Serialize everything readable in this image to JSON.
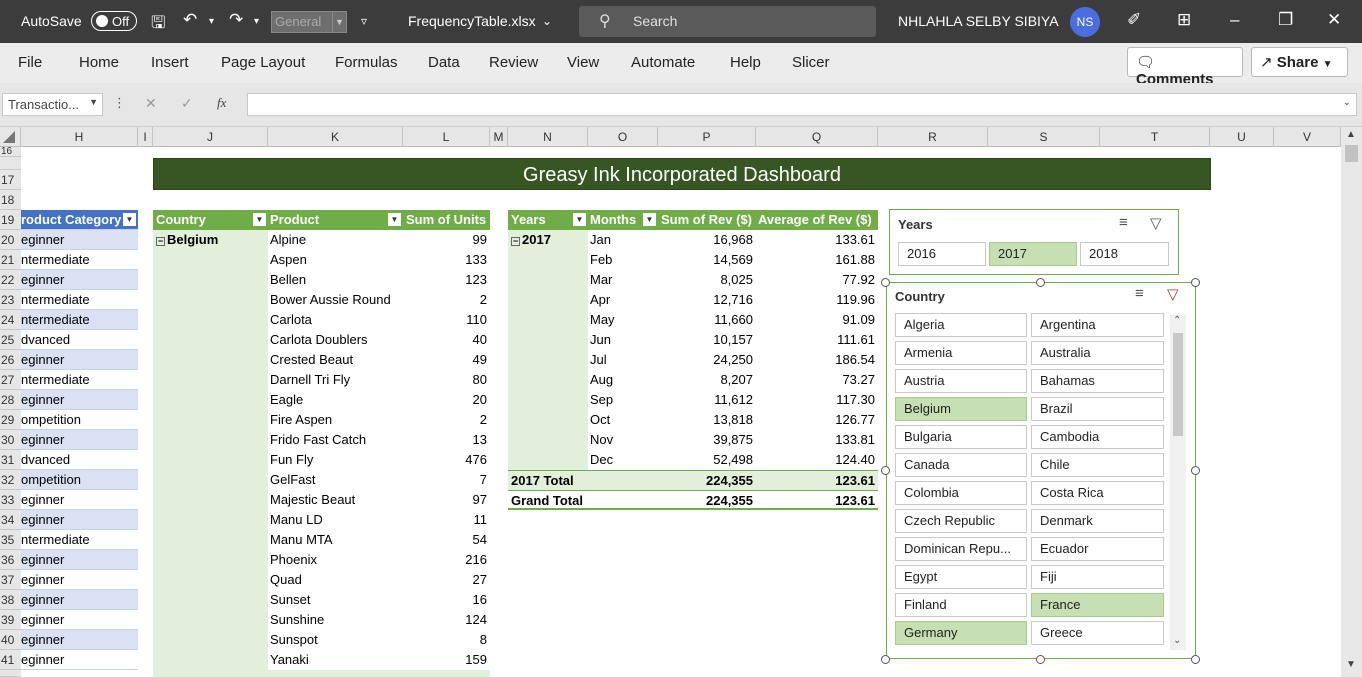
{
  "titlebar": {
    "autosave": "AutoSave",
    "toggle": "Off",
    "font": "General",
    "filename": "FrequencyTable.xlsx",
    "search": "Search",
    "user": "NHLAHLA SELBY SIBIYA",
    "initials": "NS"
  },
  "ribbon": {
    "tabs": [
      "File",
      "Home",
      "Insert",
      "Page Layout",
      "Formulas",
      "Data",
      "Review",
      "View",
      "Automate",
      "Help",
      "Slicer"
    ],
    "comments": "Comments",
    "share": "Share"
  },
  "formula": {
    "namebox": "Transactio...",
    "fx": "fx"
  },
  "columns": [
    "H",
    "I",
    "J",
    "K",
    "L",
    "M",
    "N",
    "O",
    "P",
    "Q",
    "R",
    "S",
    "T",
    "U",
    "V"
  ],
  "rows": [
    "16",
    "17",
    "18",
    "19",
    "20",
    "21",
    "22",
    "23",
    "24",
    "25",
    "26",
    "27",
    "28",
    "29",
    "30",
    "31",
    "32",
    "33",
    "34",
    "35",
    "36",
    "37",
    "38",
    "39",
    "40",
    "41"
  ],
  "colH": {
    "header": "roduct Category",
    "cells": [
      "eginner",
      "ntermediate",
      "eginner",
      "ntermediate",
      "ntermediate",
      "dvanced",
      "eginner",
      "ntermediate",
      "eginner",
      "ompetition",
      "eginner",
      "dvanced",
      "ompetition",
      "eginner",
      "eginner",
      "ntermediate",
      "eginner",
      "eginner",
      "eginner",
      "eginner",
      "eginner",
      "eginner"
    ]
  },
  "dashboard": {
    "title": "Greasy Ink Incorporated Dashboard"
  },
  "pivot1": {
    "headers": [
      "Country",
      "Product",
      "Sum of Units"
    ],
    "country": "Belgium",
    "rows": [
      [
        "Alpine",
        "99"
      ],
      [
        "Aspen",
        "133"
      ],
      [
        "Bellen",
        "123"
      ],
      [
        "Bower Aussie Round",
        "2"
      ],
      [
        "Carlota",
        "110"
      ],
      [
        "Carlota Doublers",
        "40"
      ],
      [
        "Crested Beaut",
        "49"
      ],
      [
        "Darnell Tri Fly",
        "80"
      ],
      [
        "Eagle",
        "20"
      ],
      [
        "Fire Aspen",
        "2"
      ],
      [
        "Frido Fast Catch",
        "13"
      ],
      [
        "Fun Fly",
        "476"
      ],
      [
        "GelFast",
        "7"
      ],
      [
        "Majestic Beaut",
        "97"
      ],
      [
        "Manu LD",
        "11"
      ],
      [
        "Manu MTA",
        "54"
      ],
      [
        "Phoenix",
        "216"
      ],
      [
        "Quad",
        "27"
      ],
      [
        "Sunset",
        "16"
      ],
      [
        "Sunshine",
        "124"
      ],
      [
        "Sunspot",
        "8"
      ],
      [
        "Yanaki",
        "159"
      ]
    ]
  },
  "pivot2": {
    "headers": [
      "Years",
      "Months",
      "Sum of Rev ($)",
      "Average of Rev ($)"
    ],
    "year": "2017",
    "rows": [
      [
        "Jan",
        "16,968",
        "133.61"
      ],
      [
        "Feb",
        "14,569",
        "161.88"
      ],
      [
        "Mar",
        "8,025",
        "77.92"
      ],
      [
        "Apr",
        "12,716",
        "119.96"
      ],
      [
        "May",
        "11,660",
        "91.09"
      ],
      [
        "Jun",
        "10,157",
        "111.61"
      ],
      [
        "Jul",
        "24,250",
        "186.54"
      ],
      [
        "Aug",
        "8,207",
        "73.27"
      ],
      [
        "Sep",
        "11,612",
        "117.30"
      ],
      [
        "Oct",
        "13,818",
        "126.77"
      ],
      [
        "Nov",
        "39,875",
        "133.81"
      ],
      [
        "Dec",
        "52,498",
        "124.40"
      ]
    ],
    "total": [
      "2017 Total",
      "224,355",
      "123.61"
    ],
    "grand": [
      "Grand Total",
      "224,355",
      "123.61"
    ]
  },
  "slicerYears": {
    "title": "Years",
    "items": [
      "2016",
      "2017",
      "2018"
    ],
    "selected": "2017"
  },
  "slicerCountry": {
    "title": "Country",
    "items": [
      "Algeria",
      "Argentina",
      "Armenia",
      "Australia",
      "Austria",
      "Bahamas",
      "Belgium",
      "Brazil",
      "Bulgaria",
      "Cambodia",
      "Canada",
      "Chile",
      "Colombia",
      "Costa Rica",
      "Czech Republic",
      "Denmark",
      "Dominican Repu...",
      "Ecuador",
      "Egypt",
      "Fiji",
      "Finland",
      "France",
      "Germany",
      "Greece"
    ],
    "selected": [
      "Belgium",
      "France",
      "Germany"
    ]
  },
  "colors": {
    "accent": "#70ad47",
    "dark": "#375623",
    "light": "#e2efda",
    "selected": "#c6e0b4"
  }
}
